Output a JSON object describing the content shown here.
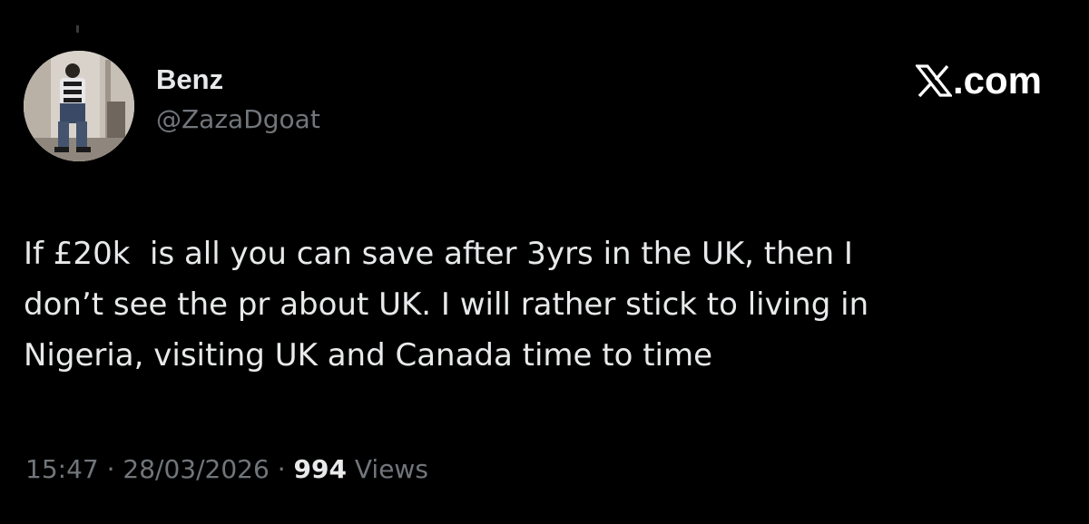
{
  "tweet": {
    "display_name": "Benz",
    "handle": "@ZazaDgoat",
    "brand": ".com",
    "brand_icon": "x-logo-icon",
    "text": "If £20k  is all you can save after 3yrs in the UK, then I\ndon’t see the pr about UK. I will rather stick to living in\nNigeria, visiting UK and Canada time to time",
    "time": "15:47",
    "separator": "·",
    "date": "28/03/2026",
    "views_count": "994",
    "views_label": "Views"
  },
  "colors": {
    "background": "#000000",
    "primary_text": "#e7e9ea",
    "secondary_text": "#71767b"
  }
}
